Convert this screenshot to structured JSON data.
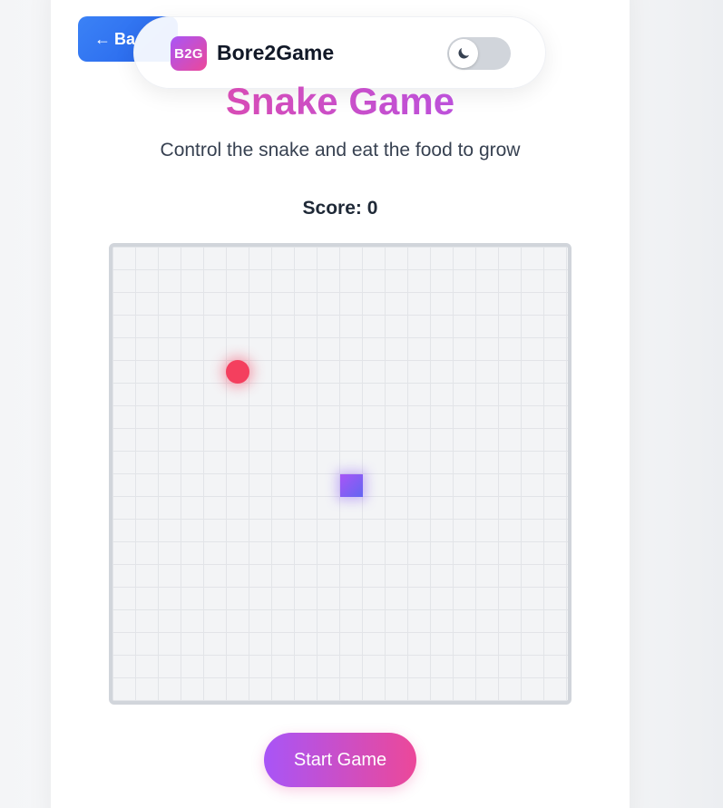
{
  "nav": {
    "back_arrow": "←",
    "back_label": "Ba"
  },
  "brand": {
    "logo_text": "B2G",
    "name": "Bore2Game",
    "theme_toggle_icon": "moon-icon",
    "theme_dark": false
  },
  "game": {
    "title": "Snake Game",
    "subtitle": "Control the snake and eat the food to grow",
    "score_label": "Score:",
    "score_value": "0",
    "start_label": "Start Game"
  },
  "board": {
    "columns": 20,
    "rows": 20,
    "food_cell": [
      5,
      5
    ],
    "snake_cells": [
      [
        10,
        10
      ]
    ]
  },
  "colors": {
    "accent_pink": "#ec4899",
    "accent_purple": "#a855f7",
    "back_blue": "#3b82f6",
    "food_red": "#f43f5e"
  }
}
